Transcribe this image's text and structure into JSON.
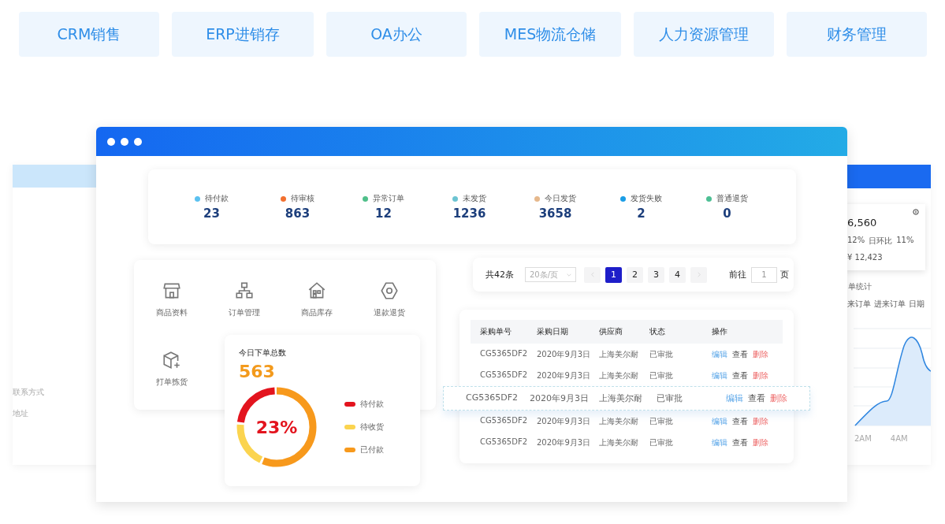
{
  "top_tabs": [
    "CRM销售",
    "ERP进销存",
    "OA办公",
    "MES物流仓储",
    "人力资源管理",
    "财务管理"
  ],
  "left_window": {
    "texts": [
      "联系方式",
      "地址"
    ]
  },
  "right_window": {
    "value": "6,560",
    "compare": [
      {
        "value": "12%"
      },
      {
        "label": "日环比",
        "value": "11%"
      }
    ],
    "total": "¥ 12,423",
    "section_title": "单统计",
    "tabs": [
      "来订单",
      "进来订单",
      "日期"
    ],
    "x_labels": [
      "2AM",
      "4AM"
    ]
  },
  "stats": [
    {
      "label": "待付款",
      "value": "23",
      "color": "#5bc1f0"
    },
    {
      "label": "待审核",
      "value": "863",
      "color": "#f2702f"
    },
    {
      "label": "异常订单",
      "value": "12",
      "color": "#4fbf8a"
    },
    {
      "label": "未发货",
      "value": "1236",
      "color": "#6cc4d2"
    },
    {
      "label": "今日发货",
      "value": "3658",
      "color": "#e6b88c"
    },
    {
      "label": "发货失败",
      "value": "2",
      "color": "#1a9de6"
    },
    {
      "label": "普通退货",
      "value": "0",
      "color": "#4dbf94"
    }
  ],
  "shortcuts": [
    "商品资料",
    "订单管理",
    "商品库存",
    "退款退货",
    "打单拣货"
  ],
  "orders_card": {
    "title": "今日下单总数",
    "total": "563",
    "percent": "23%",
    "legend": [
      {
        "label": "待付款",
        "color": "#e3141e",
        "level": 0.23
      },
      {
        "label": "待收货",
        "color": "#fbd44f",
        "level": 0.2
      },
      {
        "label": "已付款",
        "color": "#f7991c",
        "level": 0.57
      }
    ]
  },
  "pagination": {
    "total": "共42条",
    "page_size": "20条/页",
    "pages": [
      {
        "label": "1",
        "selected": true
      },
      {
        "label": "2",
        "selected": false
      },
      {
        "label": "3",
        "selected": false
      },
      {
        "label": "4",
        "selected": false
      }
    ],
    "goto_label": "前往",
    "goto_value": "1",
    "page_unit": "页"
  },
  "table": {
    "columns": [
      "采购单号",
      "采购日期",
      "供应商",
      "状态",
      "操作"
    ],
    "rows": [
      {
        "cells": [
          "CG5365DF2",
          "2020年9月3日",
          "上海美尔耐",
          "已审批"
        ],
        "highlighted": false,
        "actions": [
          {
            "label": "编辑",
            "kind": "edit"
          },
          {
            "label": "查看",
            "kind": "view"
          },
          {
            "label": "删除",
            "kind": "delete"
          }
        ]
      },
      {
        "cells": [
          "CG5365DF2",
          "2020年9月3日",
          "上海美尔耐",
          "已审批"
        ],
        "highlighted": false,
        "actions": [
          {
            "label": "编辑",
            "kind": "edit"
          },
          {
            "label": "查看",
            "kind": "view"
          },
          {
            "label": "删除",
            "kind": "delete"
          }
        ]
      },
      {
        "cells": [
          "CG5365DF2",
          "2020年9月3日",
          "上海美尔耐",
          "已审批"
        ],
        "highlighted": true,
        "actions": [
          {
            "label": "编辑",
            "kind": "edit"
          },
          {
            "label": "查看",
            "kind": "view"
          },
          {
            "label": "删除",
            "kind": "delete"
          }
        ]
      },
      {
        "cells": [
          "CG5365DF2",
          "2020年9月3日",
          "上海美尔耐",
          "已审批"
        ],
        "highlighted": false,
        "actions": [
          {
            "label": "编辑",
            "kind": "edit"
          },
          {
            "label": "查看",
            "kind": "view"
          },
          {
            "label": "删除",
            "kind": "delete"
          }
        ]
      },
      {
        "cells": [
          "CG5365DF2",
          "2020年9月3日",
          "上海美尔耐",
          "已审批"
        ],
        "highlighted": false,
        "actions": [
          {
            "label": "编辑",
            "kind": "edit"
          },
          {
            "label": "查看",
            "kind": "view"
          },
          {
            "label": "删除",
            "kind": "delete"
          }
        ]
      }
    ]
  }
}
